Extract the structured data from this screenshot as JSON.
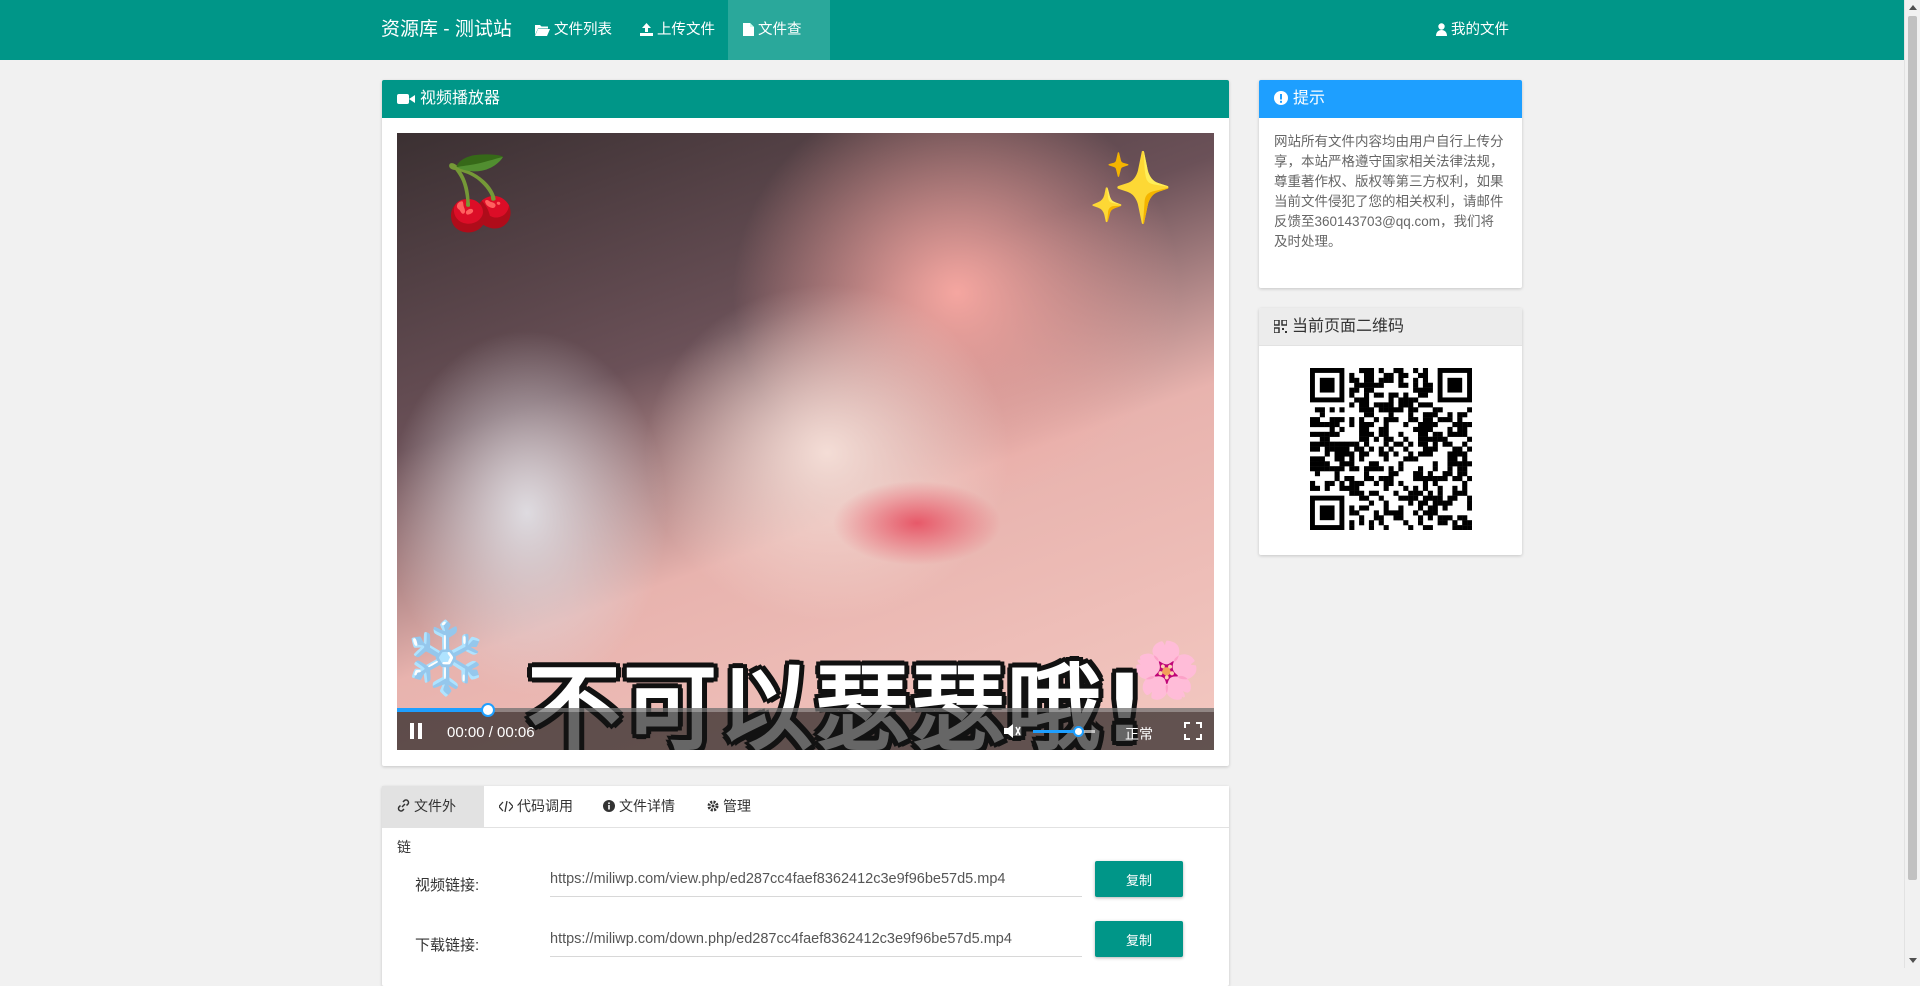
{
  "nav": {
    "brand": "资源库 - 测试站",
    "items": [
      {
        "label": "文件列表",
        "icon": "folder-open-icon"
      },
      {
        "label": "上传文件",
        "icon": "upload-icon"
      },
      {
        "label": "文件查看",
        "icon": "file-icon",
        "active": true
      }
    ],
    "my_files": "我的文件"
  },
  "player": {
    "title": "视频播放器",
    "caption": "不可以瑟瑟哦!",
    "time": "00:00 / 00:06",
    "speed": "正常",
    "progress": 0.11,
    "volume": 0.72
  },
  "tabs": [
    {
      "label": "文件外链",
      "icon": "link-icon",
      "active": true
    },
    {
      "label": "代码调用",
      "icon": "code-icon"
    },
    {
      "label": "文件详情",
      "icon": "info-icon"
    },
    {
      "label": "管理",
      "icon": "gear-icon"
    }
  ],
  "links": [
    {
      "label": "视频链接:",
      "value": "https://miliwp.com/view.php/ed287cc4faef8362412c3e9f96be57d5.mp4",
      "button": "复制"
    },
    {
      "label": "下载链接:",
      "value": "https://miliwp.com/down.php/ed287cc4faef8362412c3e9f96be57d5.mp4",
      "button": "复制"
    }
  ],
  "notice": {
    "title": "提示",
    "text": "网站所有文件内容均由用户自行上传分享，本站严格遵守国家相关法律法规，尊重著作权、版权等第三方权利，如果当前文件侵犯了您的相关权利，请邮件反馈至360143703@qq.com，我们将及时处理。"
  },
  "qrcode": {
    "title": "当前页面二维码"
  },
  "colors": {
    "primary": "#009688",
    "accent": "#1e9fff",
    "background": "#f1f1f1"
  }
}
